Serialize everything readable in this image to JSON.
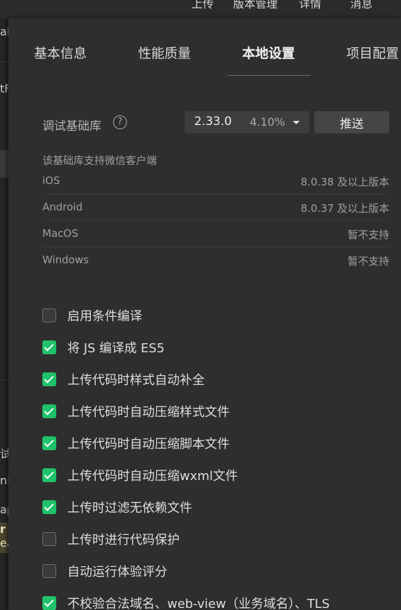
{
  "topbar": {
    "items": [
      "上传",
      "版本管理",
      "详情",
      "消息"
    ]
  },
  "left_fragments": [
    "al",
    "tF",
    "试",
    "nl",
    "ap",
    "r",
    "ea"
  ],
  "tabs": [
    {
      "label": "基本信息",
      "active": false
    },
    {
      "label": "性能质量",
      "active": false
    },
    {
      "label": "本地设置",
      "active": true
    },
    {
      "label": "项目配置",
      "active": false
    }
  ],
  "base_library": {
    "label": "调试基础库",
    "help_icon": "?",
    "version": "2.33.0",
    "percentage": "4.10%",
    "push_label": "推送"
  },
  "support": {
    "title": "该基础库支持微信客户端",
    "rows": [
      {
        "os": "iOS",
        "requirement": "8.0.38 及以上版本"
      },
      {
        "os": "Android",
        "requirement": "8.0.37 及以上版本"
      },
      {
        "os": "MacOS",
        "requirement": "暂不支持"
      },
      {
        "os": "Windows",
        "requirement": "暂不支持"
      }
    ]
  },
  "options": [
    {
      "label": "启用条件编译",
      "checked": false
    },
    {
      "label": "将 JS 编译成 ES5",
      "checked": true
    },
    {
      "label": "上传代码时样式自动补全",
      "checked": true
    },
    {
      "label": "上传代码时自动压缩样式文件",
      "checked": true
    },
    {
      "label": "上传代码时自动压缩脚本文件",
      "checked": true
    },
    {
      "label": "上传代码时自动压缩wxml文件",
      "checked": true
    },
    {
      "label": "上传时过滤无依赖文件",
      "checked": true
    },
    {
      "label": "上传时进行代码保护",
      "checked": false
    },
    {
      "label": "自动运行体验评分",
      "checked": false
    },
    {
      "label": "不校验合法域名、web-view（业务域名）、TLS",
      "checked": true
    }
  ],
  "colors": {
    "accent_green": "#1fc16b",
    "panel_bg": "#2e2e2e"
  }
}
